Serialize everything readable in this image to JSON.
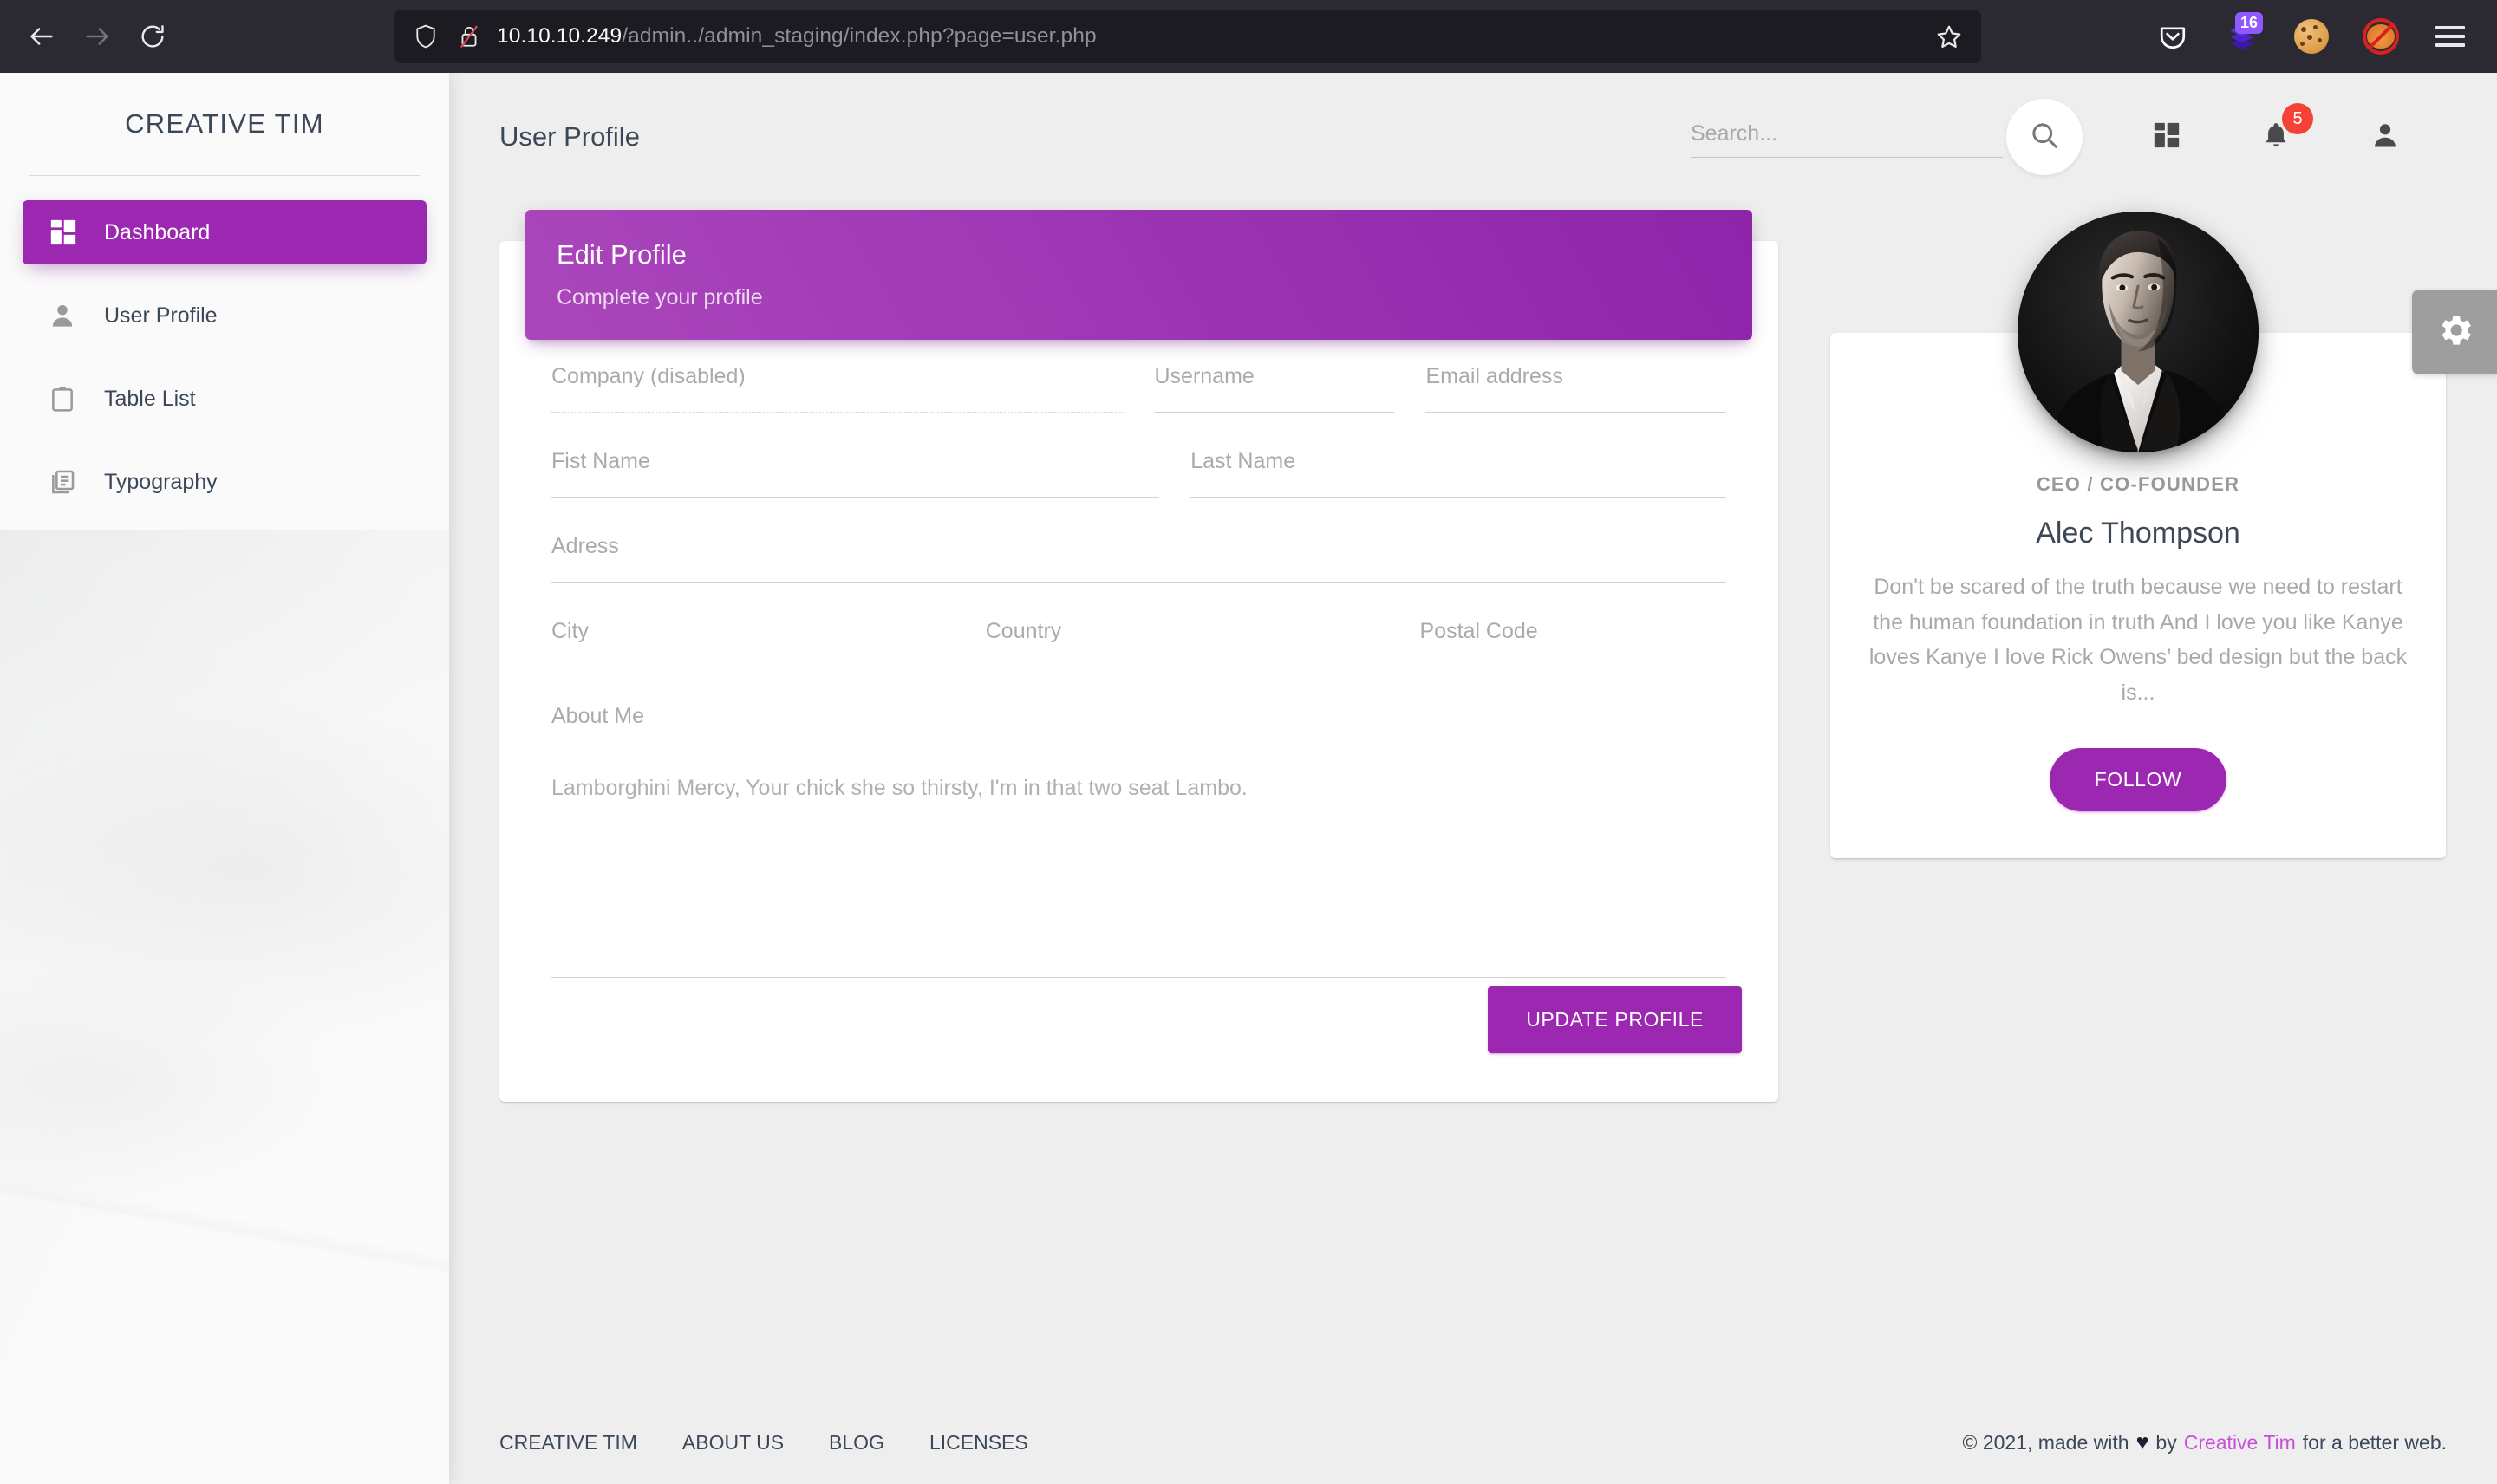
{
  "browser": {
    "url_host": "10.10.10.249",
    "url_path": "/admin../admin_staging/index.php?page=user.php",
    "back_icon": "back-arrow-icon",
    "forward_icon": "forward-arrow-icon",
    "reload_icon": "reload-icon",
    "shield_icon": "shield-icon",
    "insecure_icon": "insecure-lock-icon",
    "bookmark_icon": "star-icon",
    "pocket_icon": "pocket-icon",
    "extension_badge": "16",
    "cookie_icon": "cookie-icon",
    "fox_blocked_icon": "fox-blocked-icon",
    "menu_icon": "hamburger-menu-icon"
  },
  "sidebar": {
    "brand": "CREATIVE TIM",
    "items": [
      {
        "label": "Dashboard",
        "icon": "dashboard-icon",
        "active": true
      },
      {
        "label": "User Profile",
        "icon": "person-icon",
        "active": false
      },
      {
        "label": "Table List",
        "icon": "clipboard-icon",
        "active": false
      },
      {
        "label": "Typography",
        "icon": "library-books-icon",
        "active": false
      }
    ]
  },
  "navbar": {
    "title": "User Profile",
    "search_placeholder": "Search...",
    "search_value": "",
    "search_icon": "search-icon",
    "apps_icon": "dashboard-grid-icon",
    "notifications_icon": "bell-icon",
    "notifications_count": "5",
    "account_icon": "person-icon"
  },
  "edit_profile": {
    "title": "Edit Profile",
    "subtitle": "Complete your profile",
    "fields": {
      "company": {
        "label": "Company (disabled)",
        "value": "",
        "disabled": true
      },
      "username": {
        "label": "Username",
        "value": ""
      },
      "email": {
        "label": "Email address",
        "value": ""
      },
      "first_name": {
        "label": "Fist Name",
        "value": ""
      },
      "last_name": {
        "label": "Last Name",
        "value": ""
      },
      "address": {
        "label": "Adress",
        "value": ""
      },
      "city": {
        "label": "City",
        "value": ""
      },
      "country": {
        "label": "Country",
        "value": ""
      },
      "postal_code": {
        "label": "Postal Code",
        "value": ""
      },
      "about_me": {
        "label": "About Me",
        "value": "Lamborghini Mercy, Your chick she so thirsty, I'm in that two seat Lambo."
      }
    },
    "submit_label": "UPDATE PROFILE"
  },
  "profile_card": {
    "avatar_icon": "user-avatar-photo",
    "role": "CEO / CO-FOUNDER",
    "name": "Alec Thompson",
    "description": "Don't be scared of the truth because we need to restart the human foundation in truth And I love you like Kanye loves Kanye I love Rick Owens’ bed design but the back is...",
    "follow_label": "FOLLOW"
  },
  "settings_panel": {
    "gear_icon": "gear-icon"
  },
  "footer": {
    "links": [
      {
        "label": "CREATIVE TIM"
      },
      {
        "label": "ABOUT US"
      },
      {
        "label": "BLOG"
      },
      {
        "label": "LICENSES"
      }
    ],
    "copyright_prefix": "© 2021, made with",
    "heart": "♥",
    "copyright_by": "by",
    "brand_link": "Creative Tim",
    "copyright_suffix": "for a better web."
  },
  "colors": {
    "primary_purple": "#9c27b0",
    "header_gradient_from": "#ab47bc",
    "header_gradient_to": "#8e24aa",
    "badge_red": "#f44336",
    "text_dark": "#3c4858",
    "browser_chrome": "#2b2a33"
  }
}
